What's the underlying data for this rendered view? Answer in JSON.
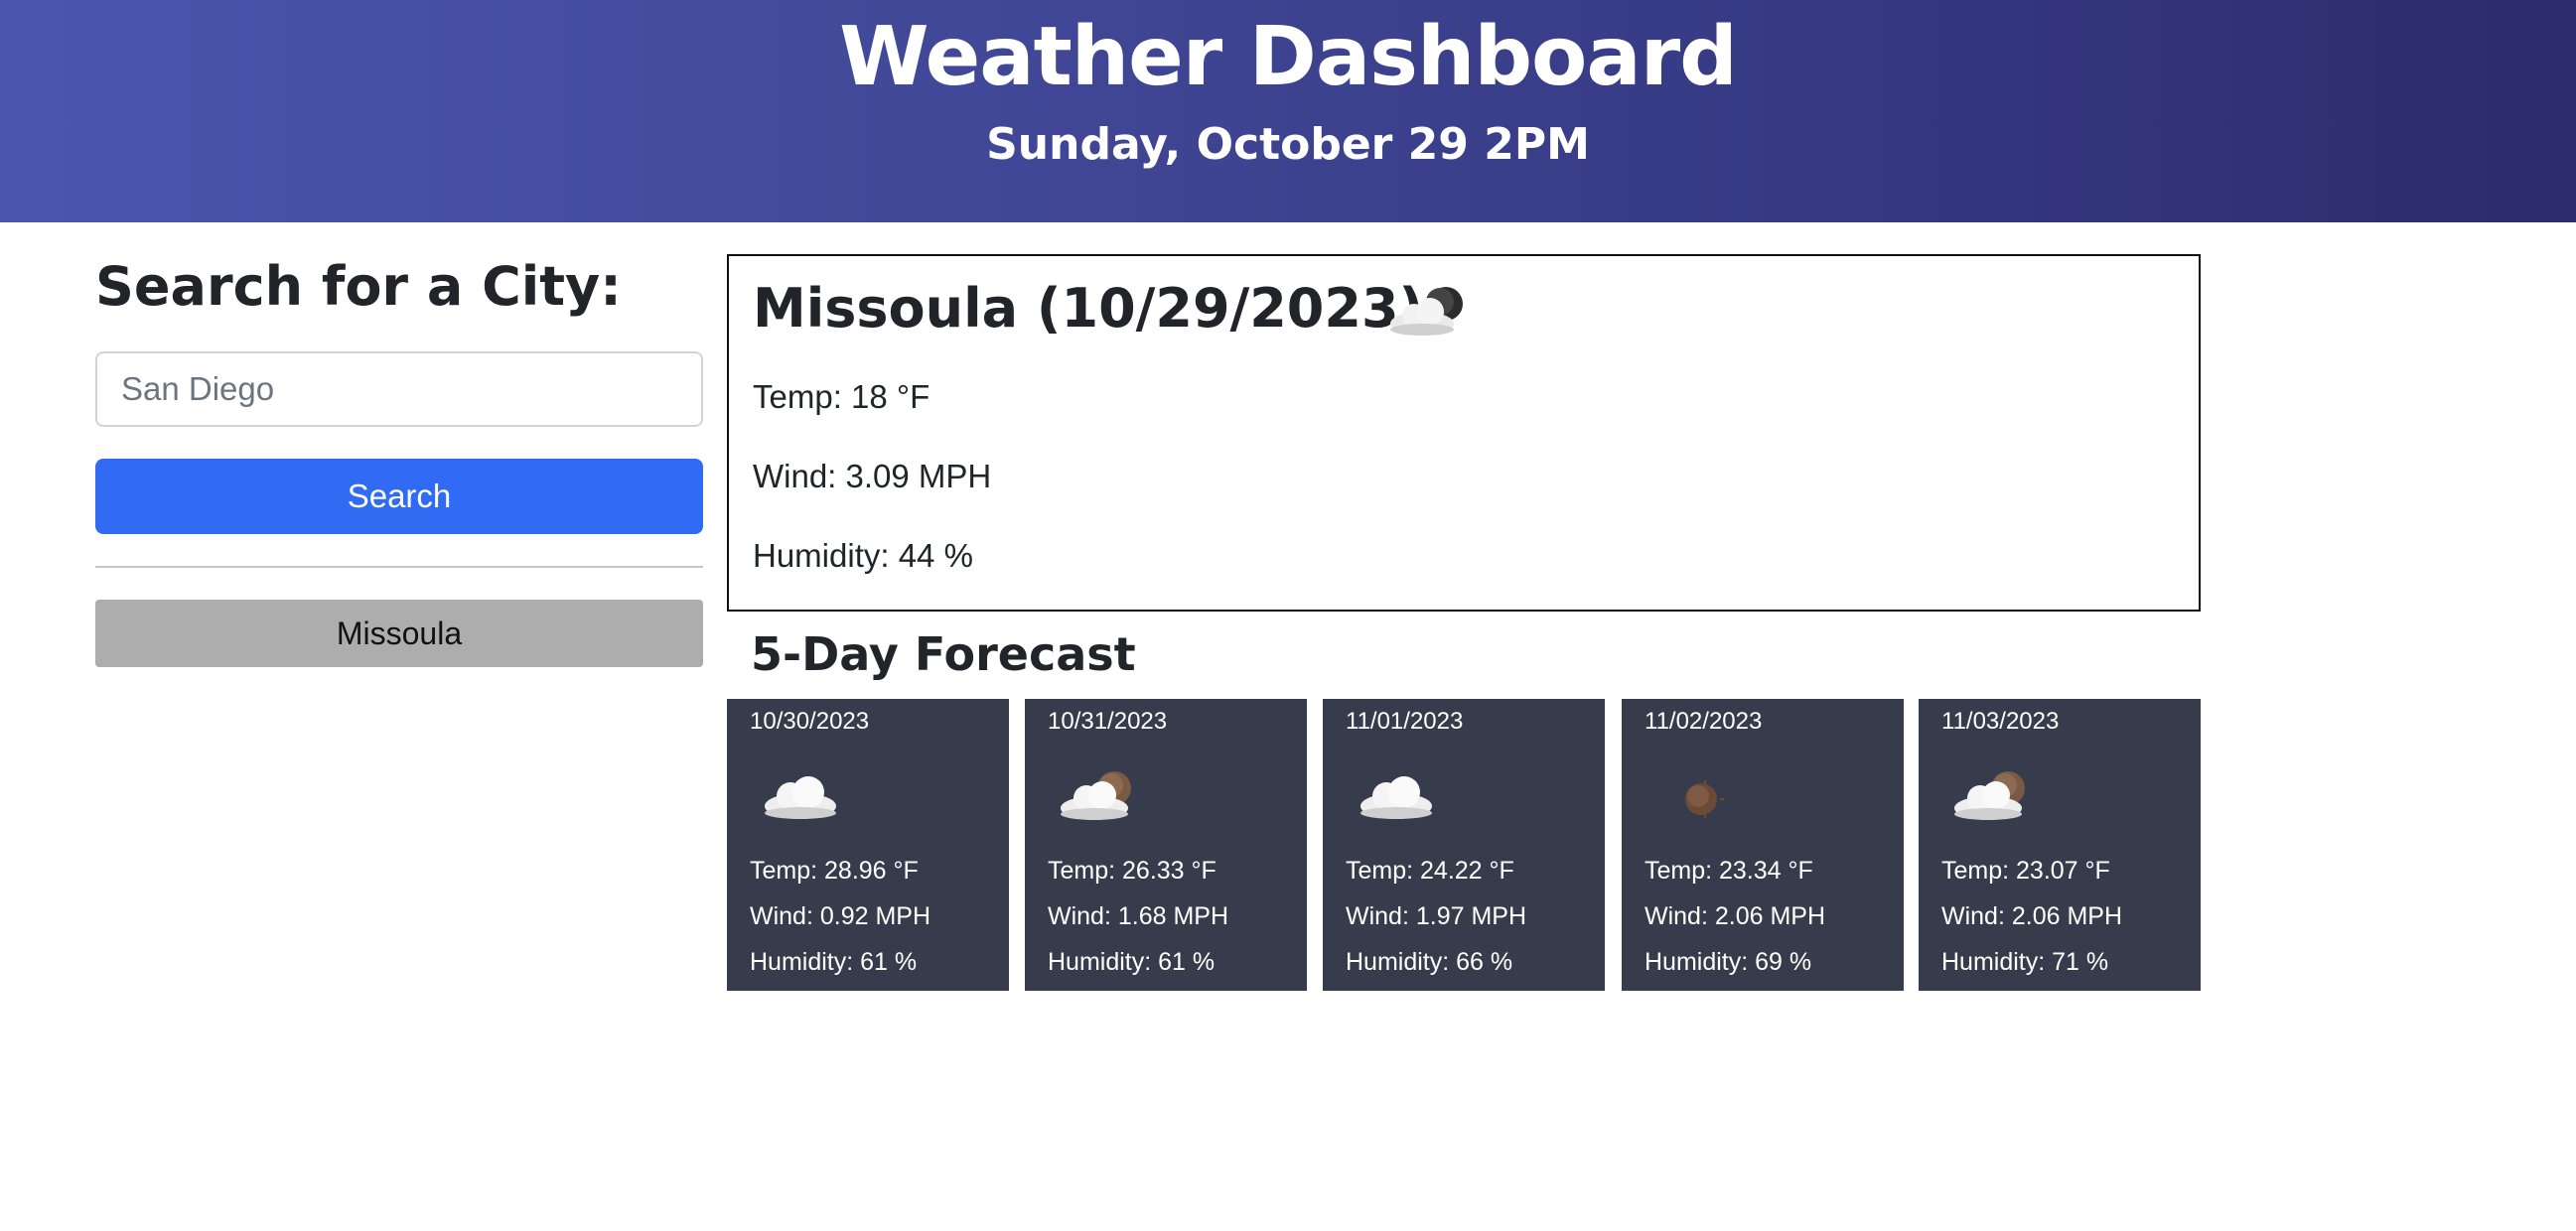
{
  "header": {
    "title": "Weather Dashboard",
    "datetime": "Sunday, October 29 2PM",
    "gradient_colors": [
      "#4a56ad",
      "#2c2b6e"
    ]
  },
  "sidebar": {
    "heading": "Search for a City:",
    "search_input": {
      "value": "",
      "placeholder": "San Diego"
    },
    "search_button": "Search",
    "search_button_color": "#316bf4",
    "history": [
      {
        "label": "Missoula"
      }
    ]
  },
  "current": {
    "title": "Missoula (10/29/2023)",
    "icon": "few-clouds-icon",
    "temp": "Temp: 18 °F",
    "wind": "Wind: 3.09 MPH",
    "humidity": "Humidity: 44 %"
  },
  "forecast": {
    "title": "5-Day Forecast",
    "card_color": "#373c4d",
    "days": [
      {
        "date": "10/30/2023",
        "icon": "cloud-icon",
        "temp": "Temp: 28.96 °F",
        "wind": "Wind: 0.92 MPH",
        "humidity": "Humidity: 61 %"
      },
      {
        "date": "10/31/2023",
        "icon": "cloud-sun-icon",
        "temp": "Temp: 26.33 °F",
        "wind": "Wind: 1.68 MPH",
        "humidity": "Humidity: 61 %"
      },
      {
        "date": "11/01/2023",
        "icon": "cloud-icon",
        "temp": "Temp: 24.22 °F",
        "wind": "Wind: 1.97 MPH",
        "humidity": "Humidity: 66 %"
      },
      {
        "date": "11/02/2023",
        "icon": "sun-icon",
        "temp": "Temp: 23.34 °F",
        "wind": "Wind: 2.06 MPH",
        "humidity": "Humidity: 69 %"
      },
      {
        "date": "11/03/2023",
        "icon": "cloud-sun-icon",
        "temp": "Temp: 23.07 °F",
        "wind": "Wind: 2.06 MPH",
        "humidity": "Humidity: 71 %"
      }
    ]
  }
}
